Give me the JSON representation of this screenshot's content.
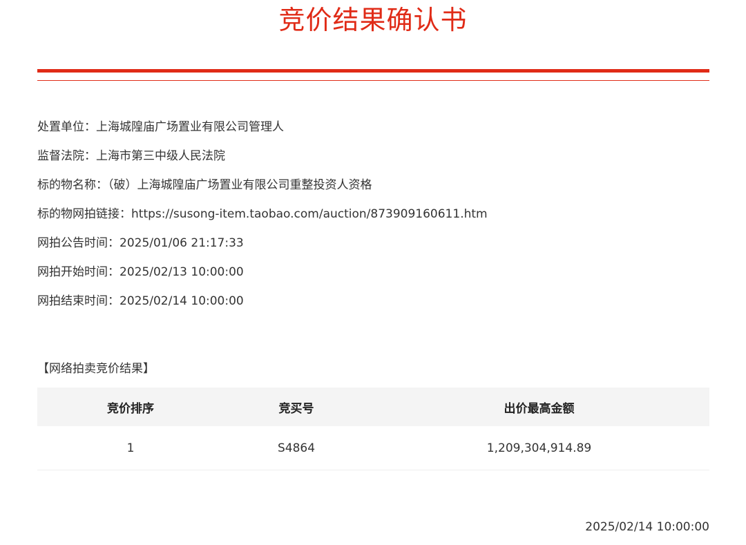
{
  "document": {
    "title": "竞价结果确认书"
  },
  "info": [
    {
      "label": "处置单位：",
      "value": "上海城隍庙广场置业有限公司管理人"
    },
    {
      "label": "监督法院：",
      "value": "上海市第三中级人民法院"
    },
    {
      "label": "标的物名称：",
      "value": "（破）上海城隍庙广场置业有限公司重整投资人资格"
    },
    {
      "label": "标的物网拍链接：",
      "value": "https://susong-item.taobao.com/auction/873909160611.htm"
    },
    {
      "label": "网拍公告时间：",
      "value": "2025/01/06 21:17:33"
    },
    {
      "label": "网拍开始时间：",
      "value": "2025/02/13 10:00:00"
    },
    {
      "label": "网拍结束时间：",
      "value": "2025/02/14 10:00:00"
    }
  ],
  "results": {
    "section_title": "【网络拍卖竞价结果】",
    "headers": [
      "竞价排序",
      "竞买号",
      "出价最高金额"
    ],
    "rows": [
      [
        "1",
        "S4864",
        "1,209,304,914.89"
      ]
    ]
  },
  "footer": {
    "date": "2025/02/14 10:00:00"
  },
  "colors": {
    "accent": "#e02b17",
    "text": "#333333",
    "header_bg": "#f4f4f4"
  }
}
